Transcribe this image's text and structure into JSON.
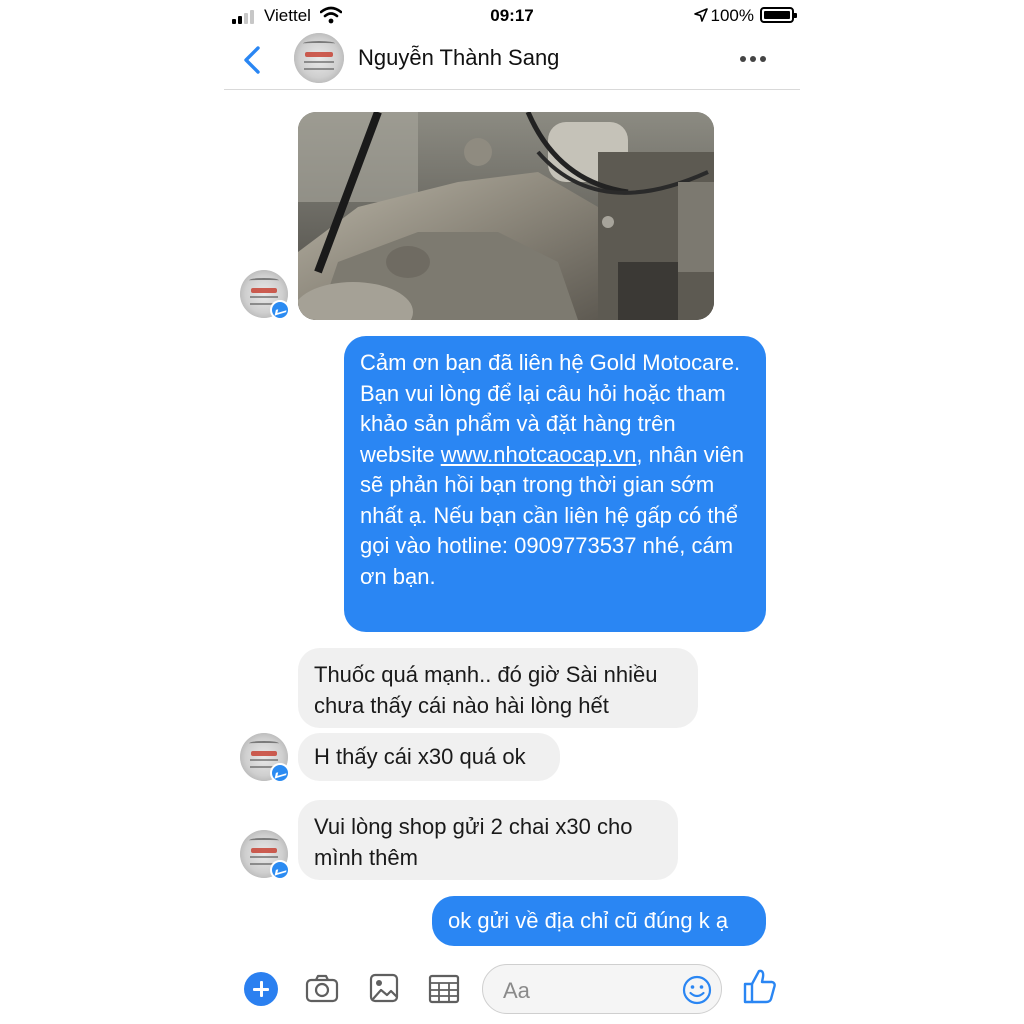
{
  "status_bar": {
    "carrier": "Viettel",
    "time": "09:17",
    "battery": "100%"
  },
  "header": {
    "contact_name": "Nguyễn Thành Sang"
  },
  "messages": [
    {
      "from": "contact",
      "type": "photo",
      "description_icon": "engine-photo"
    },
    {
      "from": "me",
      "type": "text",
      "text_before_link": "Cảm ơn bạn đã liên hệ Gold Motocare. Bạn vui lòng để lại câu hỏi hoặc tham khảo sản phẩm và đặt hàng trên website ",
      "link": "www.nhotcaocap.vn",
      "text_after_link": ", nhân viên sẽ phản hồi bạn trong thời gian sớm nhất ạ. Nếu bạn cần liên hệ gấp có thể gọi vào hotline: 0909773537 nhé, cám ơn bạn."
    },
    {
      "from": "contact",
      "type": "text",
      "text": "Thuốc quá mạnh.. đó giờ Sài nhiều chưa thấy cái nào hài lòng hết"
    },
    {
      "from": "contact",
      "type": "text",
      "text": "H thấy cái x30 quá ok"
    },
    {
      "from": "contact",
      "type": "text",
      "text": "Vui lòng shop gửi 2 chai x30 cho mình thêm"
    },
    {
      "from": "me",
      "type": "text",
      "text": "ok gửi về địa chỉ cũ đúng k ạ"
    }
  ],
  "composer": {
    "placeholder": "Aa"
  },
  "colors": {
    "accent": "#2a86f3",
    "incoming_bubble": "#f0f0f0",
    "messenger_badge": "#2b8bf2"
  }
}
